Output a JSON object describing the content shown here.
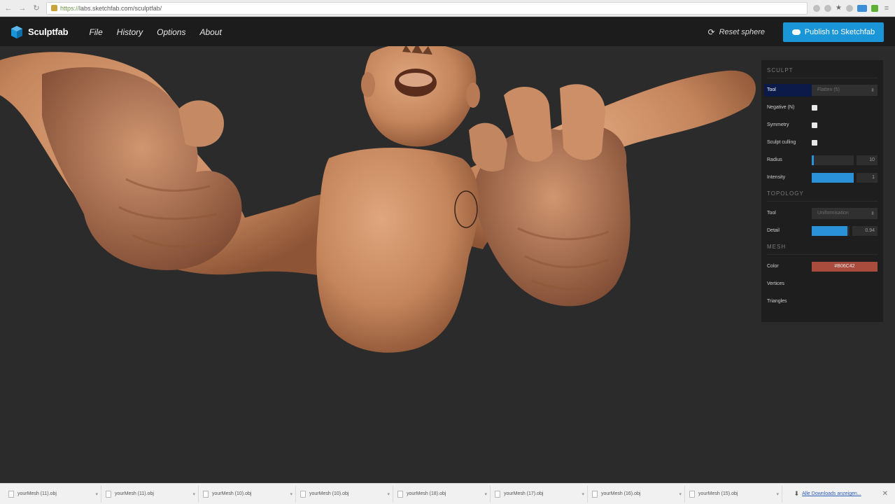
{
  "browser": {
    "url_scheme": "https://",
    "url_rest": "labs.sketchfab.com/sculptfab/"
  },
  "header": {
    "app_name": "Sculptfab",
    "menu": [
      "File",
      "History",
      "Options",
      "About"
    ],
    "reset_label": "Reset sphere",
    "publish_label": "Publish to Sketchfab"
  },
  "panel": {
    "sculpt_title": "SCULPT",
    "tool_label": "Tool",
    "tool_value": "Flatten (5)",
    "negative_label": "Negative (N)",
    "symmetry_label": "Symmetry",
    "culling_label": "Sculpt culling",
    "radius_label": "Radius",
    "radius_value": "10",
    "radius_fraction": 0.05,
    "intensity_label": "Intensity",
    "intensity_value": "1",
    "intensity_fraction": 1.0,
    "topology_title": "TOPOLOGY",
    "topo_tool_label": "Tool",
    "topo_tool_value": "Uniformisation",
    "detail_label": "Detail",
    "detail_value": "0.94",
    "detail_fraction": 0.94,
    "mesh_title": "MESH",
    "color_label": "Color",
    "color_value": "#B06C42",
    "vertices_label": "Vertices",
    "triangles_label": "Triangles"
  },
  "downloads": {
    "items": [
      "yourMesh (11).obj",
      "yourMesh (11).obj",
      "yourMesh (10).obj",
      "yourMesh (10).obj",
      "yourMesh (18).obj",
      "yourMesh (17).obj",
      "yourMesh (16).obj",
      "yourMesh (15).obj"
    ],
    "show_all": "Alle Downloads anzeigen..."
  },
  "colors": {
    "accent": "#1a95d8",
    "skin": "#c98a62",
    "background": "#2b2b2b"
  }
}
